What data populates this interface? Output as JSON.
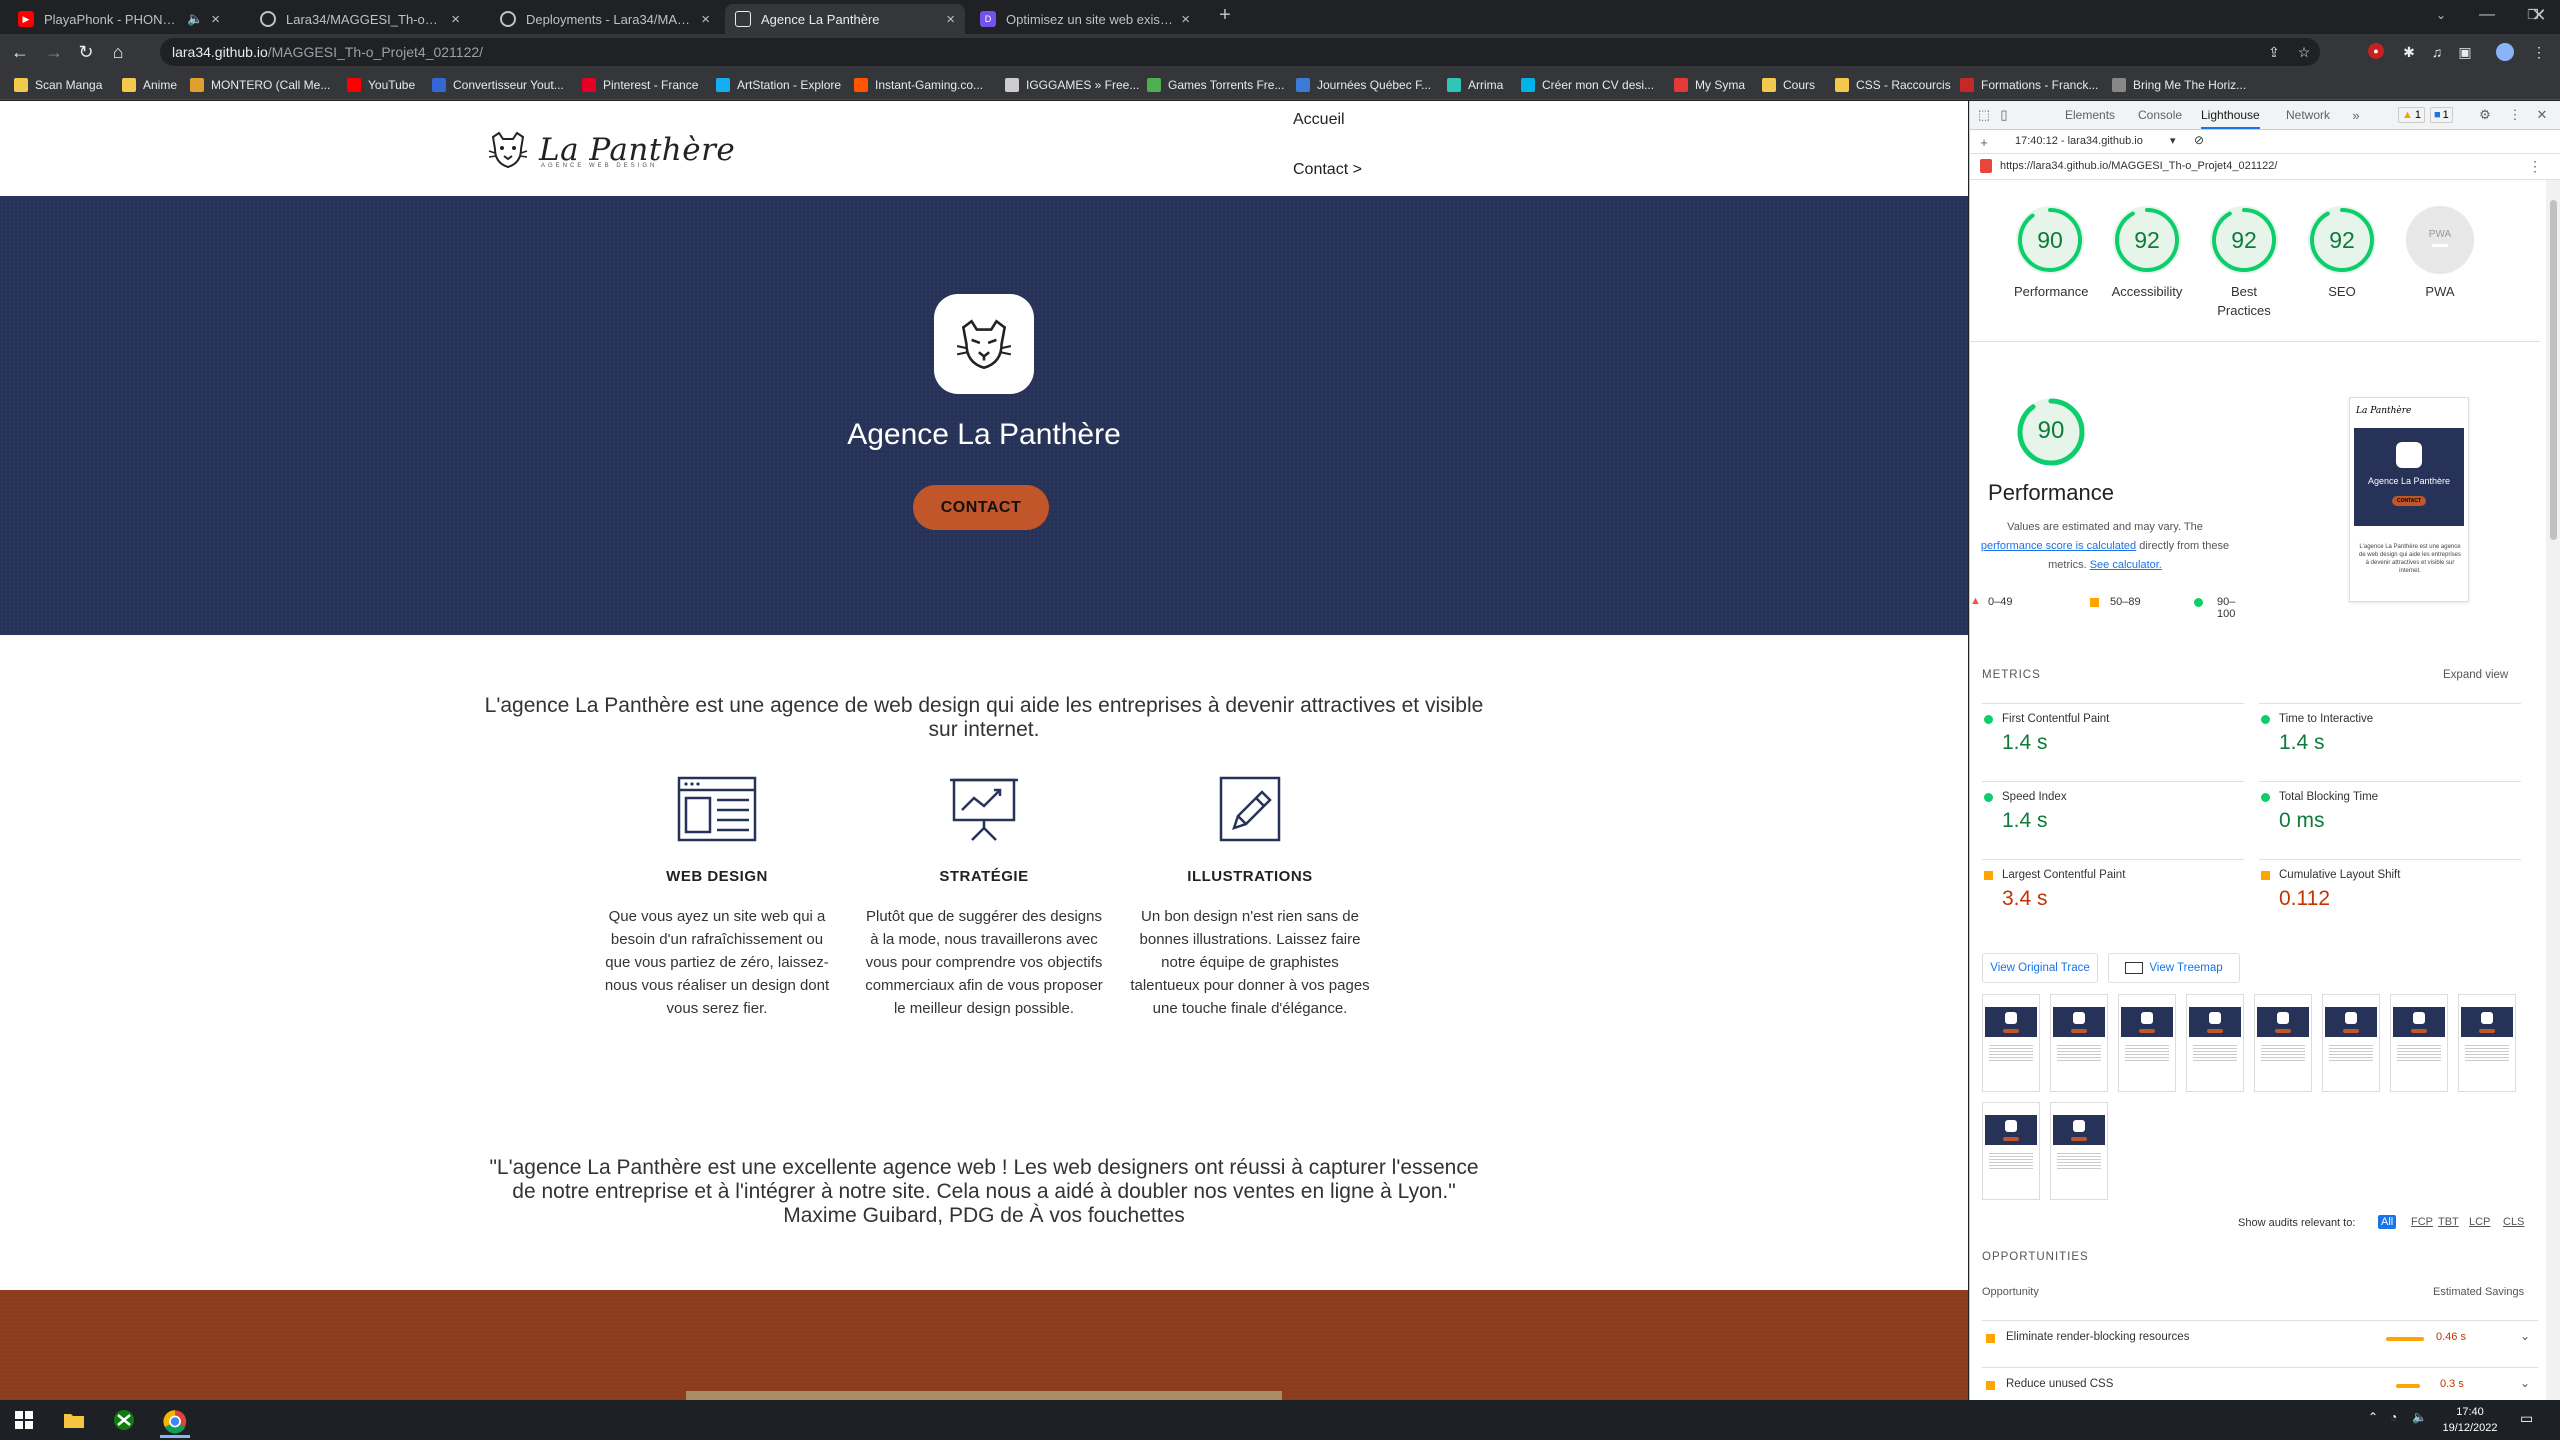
{
  "browser": {
    "tabs": [
      {
        "title": "PlayaPhonk - PHONKY TOWN",
        "icon": "youtube-icon",
        "color": "#ff0000",
        "active": false
      },
      {
        "title": "Lara34/MAGGESI_Th-o_Projet4_0",
        "icon": "github-icon",
        "color": "#202124",
        "active": false
      },
      {
        "title": "Deployments - Lara34/MAGGESI_",
        "icon": "github-icon",
        "color": "#202124",
        "active": false
      },
      {
        "title": "Agence La Panthère",
        "icon": "page-icon",
        "color": "#e8eaed",
        "active": true
      },
      {
        "title": "Optimisez un site web existant -",
        "icon": "openclassrooms-icon",
        "color": "#7451eb",
        "active": false
      }
    ],
    "url_host": "lara34.github.io",
    "url_path": "/MAGGESI_Th-o_Projet4_021122/",
    "bookmarks": [
      {
        "label": "Scan Manga",
        "color": "#f2c94c"
      },
      {
        "label": "Anime",
        "color": "#f2c94c"
      },
      {
        "label": "MONTERO (Call Me...",
        "color": "#e0a030"
      },
      {
        "label": "YouTube",
        "color": "#ff0000"
      },
      {
        "label": "Convertisseur Yout...",
        "color": "#3367d6"
      },
      {
        "label": "Pinterest - France",
        "color": "#e60023"
      },
      {
        "label": "ArtStation - Explore",
        "color": "#13aff0"
      },
      {
        "label": "Instant-Gaming.co...",
        "color": "#ff5400"
      },
      {
        "label": "IGGGAMES » Free...",
        "color": "#cccccc"
      },
      {
        "label": "Games Torrents Fre...",
        "color": "#4caf50"
      },
      {
        "label": "Journées Québec F...",
        "color": "#3a7bd5"
      },
      {
        "label": "Arrima",
        "color": "#2ec4b6"
      },
      {
        "label": "Créer mon CV desi...",
        "color": "#00b3e6"
      },
      {
        "label": "My Syma",
        "color": "#e53935"
      },
      {
        "label": "Cours",
        "color": "#f2c94c"
      },
      {
        "label": "CSS - Raccourcis",
        "color": "#f2c94c"
      },
      {
        "label": "Formations - Franck...",
        "color": "#c62828"
      },
      {
        "label": "Bring Me The Horiz...",
        "color": "#888888"
      }
    ]
  },
  "site": {
    "brand": "La Panthère",
    "brand_sub": "AGENCE WEB DESIGN",
    "nav": {
      "home": "Accueil",
      "contact": "Contact >"
    },
    "hero_title": "Agence La Panthère",
    "hero_button": "CONTACT",
    "intro": "L'agence La Panthère est une agence de web design qui aide les entreprises à devenir attractives et visible sur internet.",
    "services": [
      {
        "title": "WEB DESIGN",
        "text": "Que vous ayez un site web qui a besoin d'un rafraîchissement ou que vous partiez de zéro, laissez-nous vous réaliser un design dont vous serez fier."
      },
      {
        "title": "STRATÉGIE",
        "text": "Plutôt que de suggérer des designs à la mode, nous travaillerons avec vous pour comprendre vos objectifs commerciaux afin de vous proposer le meilleur design possible."
      },
      {
        "title": "ILLUSTRATIONS",
        "text": "Un bon design n'est rien sans de bonnes illustrations. Laissez faire notre équipe de graphistes talentueux pour donner à vos pages une touche finale d'élégance."
      }
    ],
    "quote": "\"L'agence La Panthère est une excellente agence web ! Les web designers ont réussi à capturer l'essence de notre entreprise et à l'intégrer à notre site. Cela nous a aidé à doubler nos ventes en ligne à Lyon.\" Maxime Guibard, PDG de À vos fouchettes",
    "colors": {
      "hero": "#263258",
      "accent": "#c1562a",
      "footer": "#8e3e1f"
    }
  },
  "devtools": {
    "tabs": [
      "Elements",
      "Console",
      "Lighthouse",
      "Network"
    ],
    "active_tab": "Lighthouse",
    "warnings": "1",
    "messages": "1",
    "report_time": "17:40:12 - lara34.github.io",
    "report_url": "https://lara34.github.io/MAGGESI_Th-o_Projet4_021122/",
    "scores": [
      {
        "label": "Performance",
        "value": 90
      },
      {
        "label": "Accessibility",
        "value": 92
      },
      {
        "label": "Best Practices",
        "value": 92
      },
      {
        "label": "SEO",
        "value": 92
      },
      {
        "label": "PWA",
        "value": null
      }
    ],
    "pwa_badge": "PWA",
    "perf_score": "90",
    "perf_title": "Performance",
    "perf_note_1": "Values are estimated and may vary. The",
    "perf_note_link": "performance score is calculated",
    "perf_note_2": "directly from these metrics.",
    "perf_note_link2": "See calculator.",
    "legend": [
      "0–49",
      "50–89",
      "90–100"
    ],
    "metrics_title": "METRICS",
    "expand": "Expand view",
    "metrics": [
      {
        "name": "First Contentful Paint",
        "value": "1.4 s",
        "status": "good"
      },
      {
        "name": "Time to Interactive",
        "value": "1.4 s",
        "status": "good"
      },
      {
        "name": "Speed Index",
        "value": "1.4 s",
        "status": "good"
      },
      {
        "name": "Total Blocking Time",
        "value": "0 ms",
        "status": "good"
      },
      {
        "name": "Largest Contentful Paint",
        "value": "3.4 s",
        "status": "average"
      },
      {
        "name": "Cumulative Layout Shift",
        "value": "0.112",
        "status": "average"
      }
    ],
    "view_trace": "View Original Trace",
    "view_treemap": "View Treemap",
    "filter_label": "Show audits relevant to:",
    "filters": [
      "All",
      "FCP",
      "TBT",
      "LCP",
      "CLS"
    ],
    "opportunities_title": "OPPORTUNITIES",
    "opp_col1": "Opportunity",
    "opp_col2": "Estimated Savings",
    "opportunities": [
      {
        "name": "Eliminate render-blocking resources",
        "saving": "0.46 s"
      },
      {
        "name": "Reduce unused CSS",
        "saving": "0.3 s"
      }
    ],
    "preview": {
      "brand": "La Panthère",
      "title": "Agence La Panthère",
      "button": "CONTACT",
      "text": "L'agence La Panthère est une agence de web design qui aide les entreprises à devenir attractives et visible sur internet."
    }
  },
  "taskbar": {
    "time": "17:40",
    "date": "19/12/2022"
  }
}
